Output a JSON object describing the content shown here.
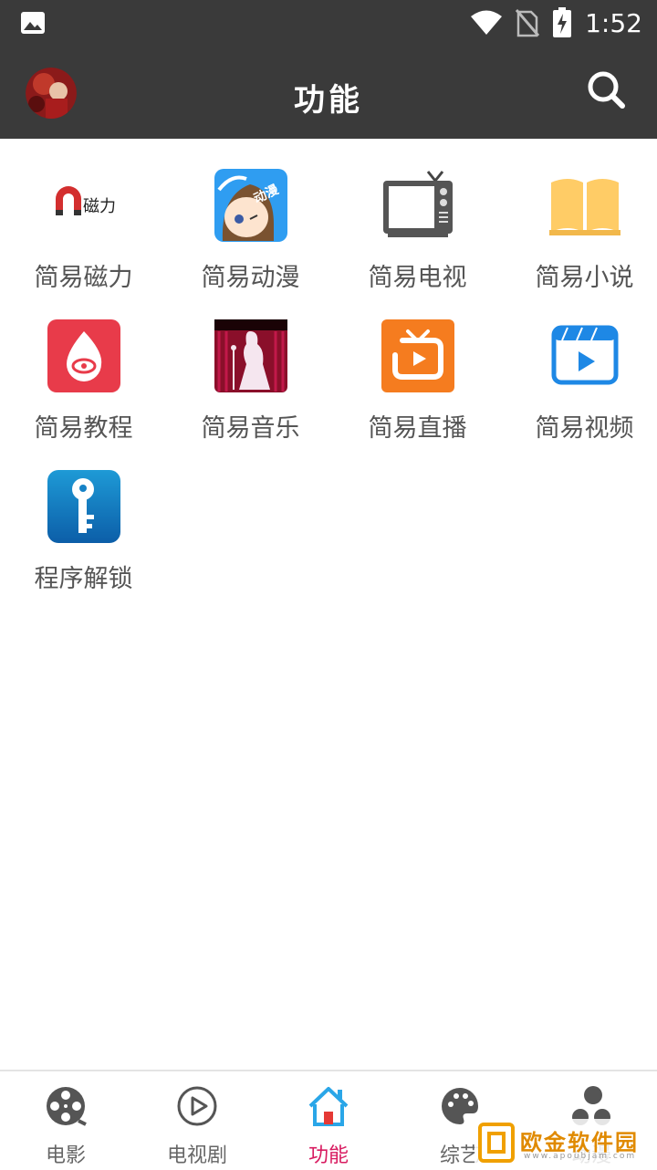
{
  "status_bar": {
    "time": "1:52"
  },
  "app_bar": {
    "title": "功能"
  },
  "grid_items": [
    {
      "label": "简易磁力",
      "icon": "magnet-icon"
    },
    {
      "label": "简易动漫",
      "icon": "anime-icon"
    },
    {
      "label": "简易电视",
      "icon": "tv-icon"
    },
    {
      "label": "简易小说",
      "icon": "book-icon"
    },
    {
      "label": "简易教程",
      "icon": "tutorial-icon"
    },
    {
      "label": "简易音乐",
      "icon": "music-icon"
    },
    {
      "label": "简易直播",
      "icon": "live-tv-icon"
    },
    {
      "label": "简易视频",
      "icon": "video-icon"
    },
    {
      "label": "程序解锁",
      "icon": "key-icon"
    }
  ],
  "magnet_icon_text": "磁力",
  "anime_icon_text": "动漫",
  "tab_bar": [
    {
      "label": "电影",
      "icon": "film-reel-icon"
    },
    {
      "label": "电视剧",
      "icon": "play-circle-icon"
    },
    {
      "label": "功能",
      "icon": "home-icon",
      "active": true
    },
    {
      "label": "综艺",
      "icon": "palette-icon"
    },
    {
      "label": "动漫",
      "icon": "bubbles-icon"
    }
  ],
  "watermark": {
    "text": "欧金软件园",
    "sub": "www.apoubjam.com"
  },
  "colors": {
    "bar": "#3a3a3a",
    "active": "#d81b60",
    "accent_blue": "#2196f3"
  }
}
